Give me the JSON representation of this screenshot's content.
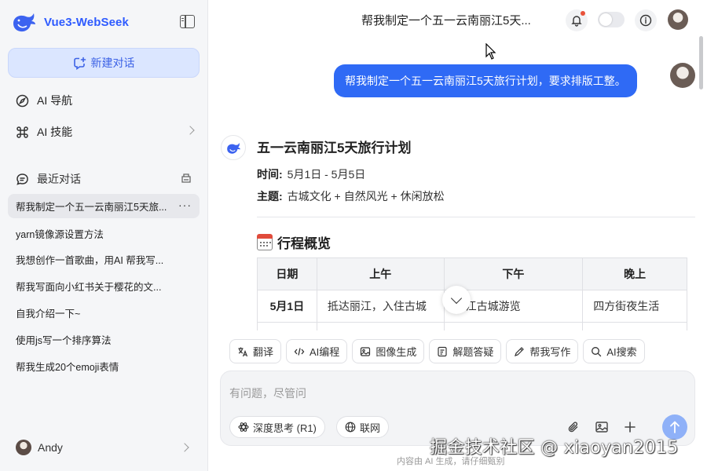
{
  "app": {
    "name": "Vue3-WebSeek",
    "brand_color": "#2e5bff",
    "accent_color": "#2f6af5"
  },
  "sidebar": {
    "collapse_icon": "sidebar-toggle-icon",
    "new_chat_label": "新建对话",
    "nav": [
      {
        "label": "AI 导航",
        "icon": "compass-icon"
      },
      {
        "label": "AI 技能",
        "icon": "command-icon"
      }
    ],
    "recent_label": "最近对话",
    "conversations": [
      "帮我制定一个五一云南丽江5天旅...",
      "yarn镜像源设置方法",
      "我想创作一首歌曲，用AI 帮我写...",
      "帮我写面向小红书关于樱花的文...",
      "自我介绍一下~",
      "使用js写一个排序算法",
      "帮我生成20个emoji表情"
    ],
    "more_label": "···",
    "user_name": "Andy"
  },
  "header": {
    "title": "帮我制定一个五一云南丽江5天..."
  },
  "chat": {
    "user_message": "帮我制定一个五一云南丽江5天旅行计划，要求排版工整。",
    "answer": {
      "title": "五一云南丽江5天旅行计划",
      "time_label": "时间:",
      "time_value": "5月1日 - 5月5日",
      "theme_label": "主题:",
      "theme_value": "古城文化 + 自然风光 + 休闲放松",
      "section_title": "行程概览",
      "table": {
        "headers": [
          "日期",
          "上午",
          "下午",
          "晚上"
        ],
        "rows": [
          [
            "5月1日",
            "抵达丽江，入住古城",
            "丽江古城游览",
            "四方街夜生活"
          ]
        ]
      }
    }
  },
  "quick_actions": [
    "翻译",
    "AI编程",
    "图像生成",
    "解题答疑",
    "帮我写作",
    "AI搜索"
  ],
  "composer": {
    "placeholder": "有问题，尽管问",
    "deep_think_label": "深度思考 (R1)",
    "web_label": "联网"
  },
  "footer_note": "内容由 AI 生成，请仔细甄别",
  "watermark": "掘金技术社区 @ xiaoyan2015"
}
